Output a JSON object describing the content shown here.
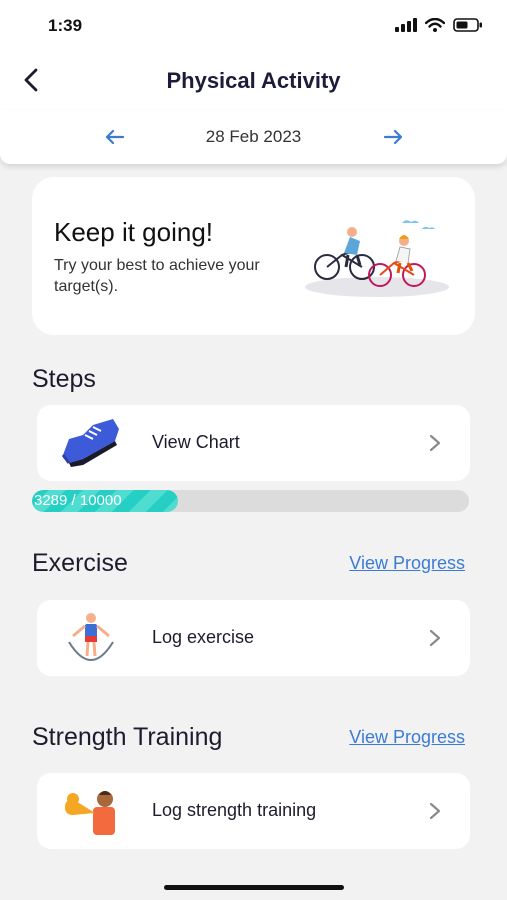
{
  "status_bar": {
    "time": "1:39"
  },
  "header": {
    "title": "Physical Activity"
  },
  "date_nav": {
    "date": "28 Feb 2023"
  },
  "hero": {
    "title": "Keep it going!",
    "subtitle": "Try your best to achieve your target(s)."
  },
  "steps": {
    "title": "Steps",
    "row_label": "View Chart",
    "progress_text": "3289 / 10000",
    "current": 3289,
    "target": 10000
  },
  "exercise": {
    "title": "Exercise",
    "link": "View Progress",
    "row_label": "Log exercise"
  },
  "strength": {
    "title": "Strength Training",
    "link": "View Progress",
    "row_label": "Log strength training"
  },
  "icons": {
    "back": "chevron-left-icon",
    "prev": "arrow-left-icon",
    "next": "arrow-right-icon",
    "chevron": "chevron-right-icon",
    "shoe": "running-shoe-icon",
    "jump_rope": "jump-rope-icon",
    "muscle": "flexed-arm-icon"
  },
  "colors": {
    "accent_blue": "#3b7bd4",
    "progress_teal": "#25cfc3",
    "track_gray": "#dcdcdc"
  }
}
